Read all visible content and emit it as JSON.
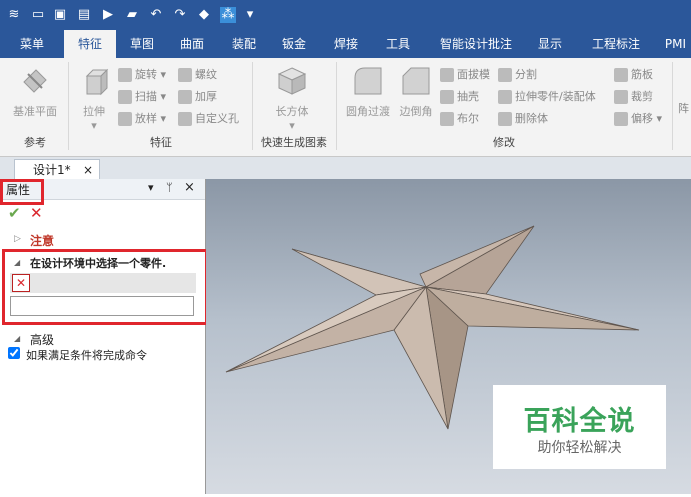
{
  "quick_access": [
    "≋",
    "▭",
    "▣",
    "▤",
    "▶",
    "▰",
    "↶",
    "↷",
    "◆",
    "⁂",
    "▾"
  ],
  "tabs": [
    {
      "label": "菜单"
    },
    {
      "label": "特征"
    },
    {
      "label": "草图"
    },
    {
      "label": "曲面"
    },
    {
      "label": "装配"
    },
    {
      "label": "钣金"
    },
    {
      "label": "焊接"
    },
    {
      "label": "工具"
    },
    {
      "label": "智能设计批注"
    },
    {
      "label": "显示"
    },
    {
      "label": "工程标注"
    },
    {
      "label": "PMI"
    }
  ],
  "ribbon": {
    "ref_button": "基准平面",
    "ref_group": "参考",
    "extrude_button": "拉伸",
    "feature_small": [
      "旋转",
      "扫描",
      "放样",
      "螺纹",
      "加厚",
      "自定义孔"
    ],
    "feature_group": "特征",
    "box_button": "长方体",
    "quick_group": "快速生成图素",
    "fillet_button": "圆角过渡",
    "chamfer_button": "边倒角",
    "modify_small": [
      "面拔模",
      "抽壳",
      "布尔",
      "分割",
      "拉伸零件/装配体",
      "删除体",
      "筋板",
      "裁剪",
      "偏移"
    ],
    "modify_group": "修改",
    "cut_label": "阵"
  },
  "doc_tab": {
    "label": "设计1*",
    "close": "×"
  },
  "panel": {
    "title": "属性",
    "controls": [
      "▾",
      "ᛘ",
      "×"
    ],
    "confirm": "✔",
    "cancel": "✕",
    "note_toggle": "▷",
    "note_label": "注意",
    "select_toggle": "◢",
    "select_label": "在设计环境中选择一个零件.",
    "input_value": "",
    "advanced_toggle": "◢",
    "advanced_label": "高级",
    "complete_label": "如果满足条件将完成命令",
    "complete_checked": true
  },
  "watermark": {
    "title": "百科全说",
    "subtitle": "助你轻松解决"
  },
  "colors": {
    "accent": "#2b579a",
    "highlight": "#e0262d",
    "star": "#c9b8ab",
    "watermark_green": "#3aa35a"
  }
}
